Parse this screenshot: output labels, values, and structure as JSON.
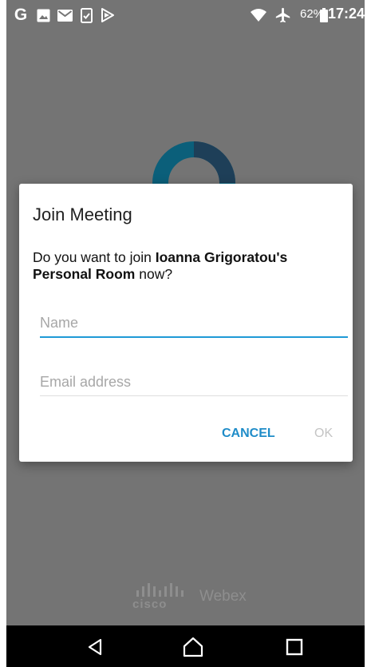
{
  "status_bar": {
    "left_letter": "G",
    "notification_icons": [
      "google-icon",
      "photo-icon",
      "mail-icon",
      "checkbox-icon",
      "play-store-icon"
    ],
    "right_icons": [
      "wifi-icon",
      "airplane-icon",
      "battery-icon"
    ],
    "battery_percent": "62%",
    "time": "17:24"
  },
  "background": {
    "brand_cisco": "cisco",
    "brand_webex": "Webex"
  },
  "dialog": {
    "title": "Join Meeting",
    "message_prefix": "Do you want to join ",
    "message_bold": "Ioanna Grigoratou's Personal Room",
    "message_suffix": " now?",
    "name_field": {
      "placeholder": "Name",
      "value": ""
    },
    "email_field": {
      "placeholder": "Email address",
      "value": ""
    },
    "cancel_label": "CANCEL",
    "ok_label": "OK"
  },
  "colors": {
    "accent": "#1f9ad6",
    "scrim_background": "#747474",
    "disabled_text": "#c4c4c4"
  }
}
